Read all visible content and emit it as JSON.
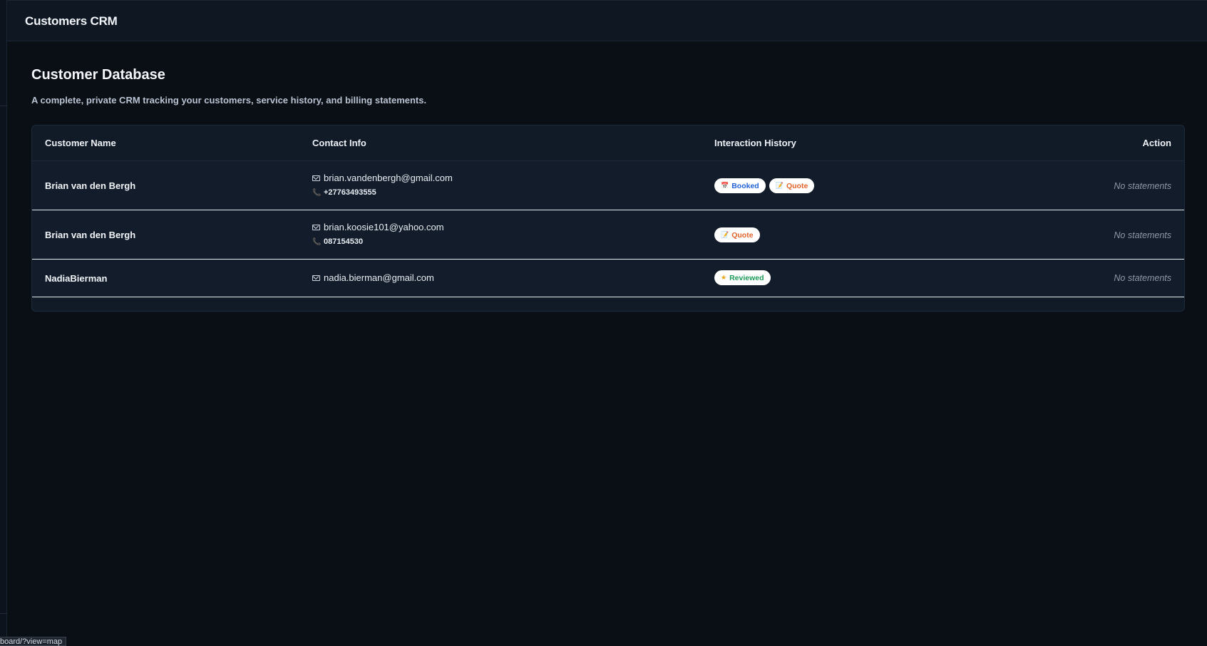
{
  "app": {
    "title": "Customers CRM"
  },
  "page": {
    "title": "Customer Database",
    "subtitle": "A complete, private CRM tracking your customers, service history, and billing statements."
  },
  "table": {
    "headers": {
      "name": "Customer Name",
      "contact": "Contact Info",
      "history": "Interaction History",
      "action": "Action"
    },
    "rows": [
      {
        "name": "Brian van den Bergh",
        "email": "brian.vandenbergh@gmail.com",
        "phone": "+27763493555",
        "badges": [
          "Booked",
          "Quote"
        ],
        "action": "No statements"
      },
      {
        "name": "Brian van den Bergh",
        "email": "brian.koosie101@yahoo.com",
        "phone": "087154530",
        "badges": [
          "Quote"
        ],
        "action": "No statements"
      },
      {
        "name": "NadiaBierman",
        "email": "nadia.bierman@gmail.com",
        "phone": "",
        "badges": [
          "Reviewed"
        ],
        "action": "No statements"
      }
    ]
  },
  "badge_icons": {
    "Booked": "calendar-icon",
    "Quote": "memo-icon",
    "Reviewed": "star-icon"
  },
  "colors": {
    "background": "#0a0e15",
    "booked": "#2563d6",
    "quote": "#e0632b",
    "reviewed": "#1f9a58"
  },
  "status_bar": {
    "url": "board/?view=map"
  }
}
